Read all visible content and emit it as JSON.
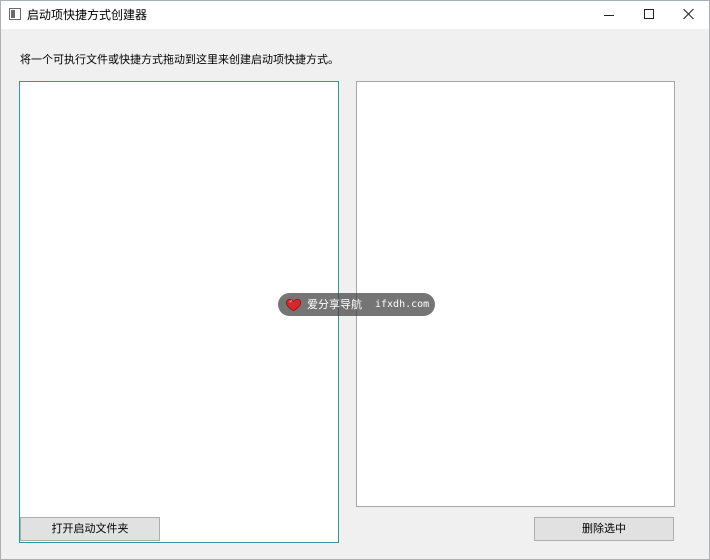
{
  "window": {
    "title": "启动项快捷方式创建器",
    "app_icon": "window-app-icon",
    "controls": {
      "minimize_icon": "minimize-icon",
      "maximize_icon": "maximize-icon",
      "close_icon": "close-icon"
    }
  },
  "main": {
    "instruction": "将一个可执行文件或快捷方式拖动到这里来创建启动项快捷方式。",
    "left_panel": {
      "items": []
    },
    "right_panel": {
      "items": []
    },
    "open_folder_button": "打开启动文件夹",
    "delete_selected_button": "删除选中"
  },
  "watermark": {
    "icon": "heart-icon",
    "text": "爱分享导航",
    "url": "ifxdh.com"
  },
  "colors": {
    "window_bg": "#f0f0f0",
    "panel_bg": "#ffffff",
    "focus_border": "#2a9a9a",
    "button_bg": "#e1e1e1",
    "heart": "#d9262b"
  }
}
